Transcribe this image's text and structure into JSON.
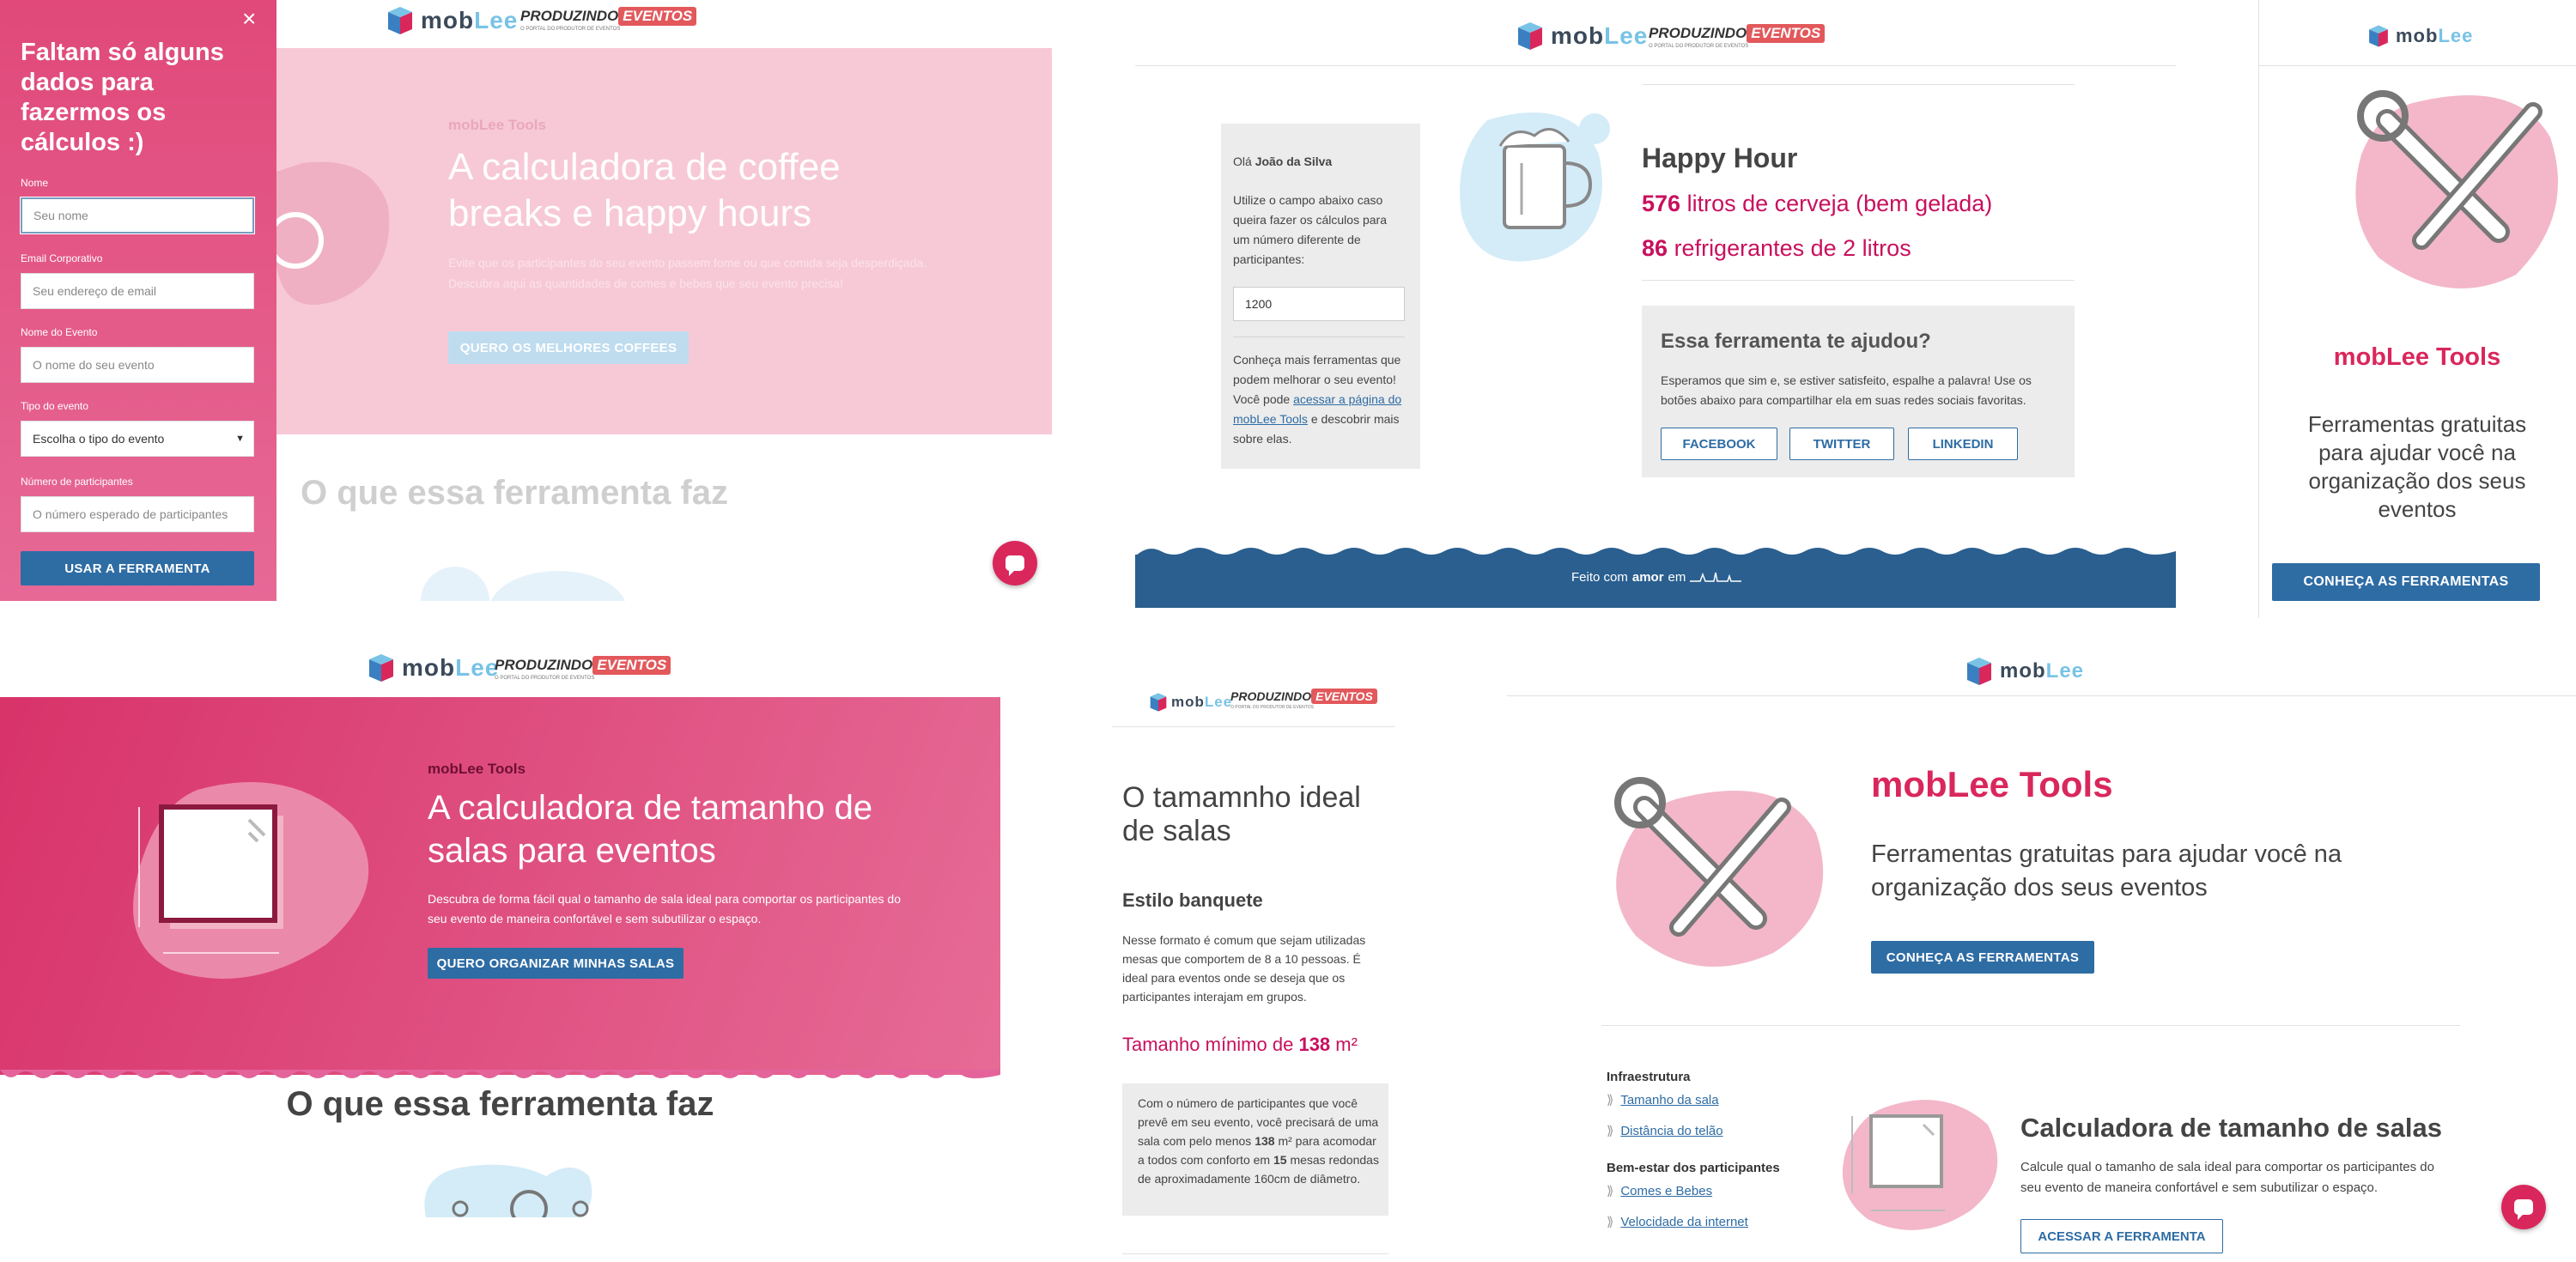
{
  "brand": {
    "logo_text_mob": "mob",
    "logo_text_lee": "Lee",
    "pe_prod": "PRODUZINDO",
    "pe_ev": "EVENTOS",
    "pe_sub": "O PORTAL DO PRODUTOR DE EVENTOS"
  },
  "colors": {
    "pink": "#d9275c",
    "blue": "#2e6ca4",
    "navy": "#2a5f8f",
    "light_pink": "#f7c9d7"
  },
  "panel1": {
    "close": "×",
    "form_title": "Faltam só alguns dados para fazermos os cálculos :)",
    "name_label": "Nome",
    "name_placeholder": "Seu nome",
    "email_label": "Email Corporativo",
    "email_placeholder": "Seu endereço de email",
    "event_label": "Nome do Evento",
    "event_placeholder": "O nome do seu evento",
    "type_label": "Tipo do evento",
    "type_value": "Escolha o tipo do evento",
    "participants_label": "Número de participantes",
    "participants_placeholder": "O número esperado de participantes",
    "submit": "USAR A FERRAMENTA",
    "eyebrow": "mobLee Tools",
    "hero_title": "A calculadora de coffee breaks e happy hours",
    "hero_desc": "Evite que os participantes do seu evento passem fome ou que comida seja desperdiçada. Descubra aqui as quantidades de comes e bebes que seu evento precisa!",
    "hero_button": "QUERO OS MELHORES COFFEES",
    "section_title": "O que essa ferramenta faz"
  },
  "panel2": {
    "greeting_prefix": "Olá",
    "greeting_name": "João da Silva",
    "side_text": "Utilize o campo abaixo caso queira fazer os cálculos para um número diferente de participantes:",
    "participants_value": "1200",
    "more_prefix": "Conheça mais ferramentas que podem melhorar o seu evento! Você pode",
    "more_link": "acessar a página do mobLee Tools",
    "more_suffix": "e descobrir mais sobre elas.",
    "result_title": "Happy Hour",
    "beer_count": "576",
    "beer_text": "litros de cerveja (bem gelada)",
    "soda_count": "86",
    "soda_text": "refrigerantes de 2 litros",
    "help_title": "Essa ferramenta te ajudou?",
    "help_text": "Esperamos que sim e, se estiver satisfeito, espalhe a palavra! Use os botões abaixo para compartilhar ela em suas redes sociais favoritas.",
    "share": [
      "FACEBOOK",
      "TWITTER",
      "LINKEDIN"
    ],
    "footer_prefix": "Feito com",
    "footer_bold": "amor",
    "footer_suffix": "em"
  },
  "panel3": {
    "title": "mobLee Tools",
    "subtitle": "Ferramentas gratuitas para ajudar você na organização dos seus eventos",
    "button": "CONHEÇA AS FERRAMENTAS"
  },
  "panel4": {
    "eyebrow": "mobLee Tools",
    "hero_title": "A calculadora de tamanho de salas para eventos",
    "hero_desc": "Descubra de forma fácil qual o tamanho de sala ideal para comportar os participantes do seu evento de maneira confortável e sem subutilizar o espaço.",
    "hero_button": "QUERO ORGANIZAR MINHAS SALAS",
    "section_title": "O que essa ferramenta faz"
  },
  "panel5": {
    "title": "O tamamnho ideal de salas",
    "subtitle": "Estilo banquete",
    "desc": "Nesse formato é comum que sejam utilizadas mesas que comportem de 8 a 10 pessoas. É ideal para eventos onde se deseja que os participantes interajam em grupos.",
    "size_prefix": "Tamanho mínimo de",
    "size_value": "138",
    "size_unit": "m²",
    "box_p1": "Com o número de participantes que você prevê em seu evento, você precisará de uma sala com pelo menos",
    "box_v1": "138",
    "box_p2": "m² para acomodar a todos com conforto em",
    "box_v2": "15",
    "box_p3": "mesas redondas de aproximadamente 160cm de diâmetro."
  },
  "panel6": {
    "title": "mobLee Tools",
    "subtitle": "Ferramentas gratuitas para ajudar você na organização dos seus eventos",
    "button": "CONHEÇA AS FERRAMENTAS",
    "cat1": "Infraestrutura",
    "cat1_items": [
      "Tamanho da sala",
      "Distância do telão"
    ],
    "cat2": "Bem-estar dos participantes",
    "cat2_items": [
      "Comes e Bebes",
      "Velocidade da internet"
    ],
    "tool_title": "Calculadora de tamanho de salas",
    "tool_desc": "Calcule qual o tamanho de sala ideal para comportar os participantes do seu evento de maneira confortável e sem subutilizar o espaço.",
    "tool_button": "ACESSAR A FERRAMENTA"
  }
}
